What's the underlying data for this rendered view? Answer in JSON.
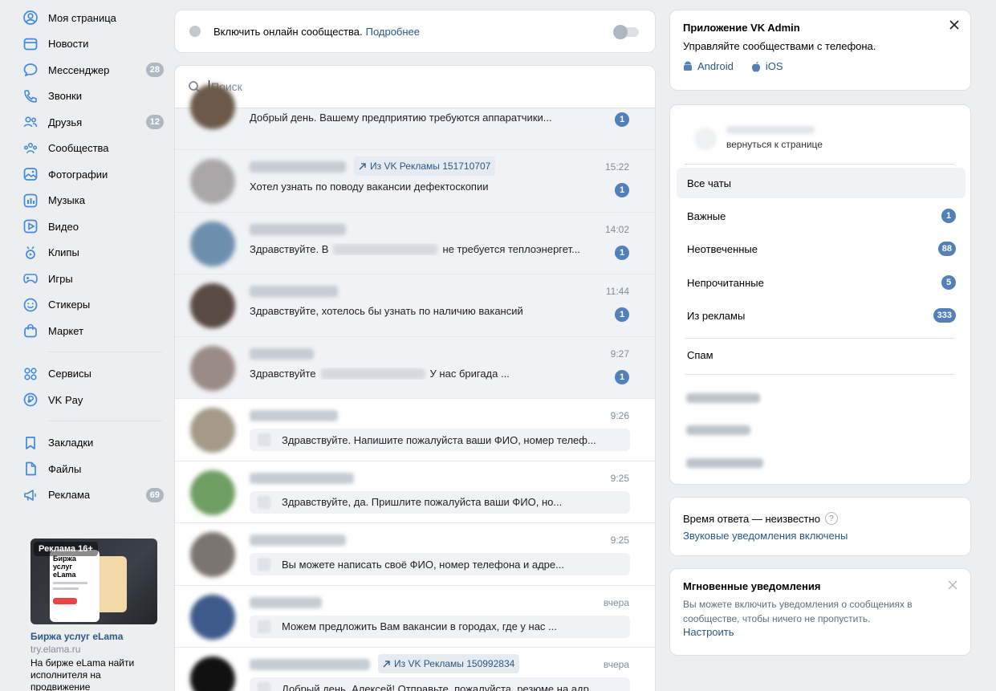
{
  "nav": {
    "items": [
      {
        "label": "Моя страница",
        "icon": "user-circle-icon",
        "count": ""
      },
      {
        "label": "Новости",
        "icon": "news-icon",
        "count": ""
      },
      {
        "label": "Мессенджер",
        "icon": "message-icon",
        "count": "28"
      },
      {
        "label": "Звонки",
        "icon": "phone-icon",
        "count": ""
      },
      {
        "label": "Друзья",
        "icon": "friends-icon",
        "count": "12"
      },
      {
        "label": "Сообщества",
        "icon": "communities-icon",
        "count": ""
      },
      {
        "label": "Фотографии",
        "icon": "photo-icon",
        "count": ""
      },
      {
        "label": "Музыка",
        "icon": "music-icon",
        "count": ""
      },
      {
        "label": "Видео",
        "icon": "video-icon",
        "count": ""
      },
      {
        "label": "Клипы",
        "icon": "clips-icon",
        "count": ""
      },
      {
        "label": "Игры",
        "icon": "gamepad-icon",
        "count": ""
      },
      {
        "label": "Стикеры",
        "icon": "smile-icon",
        "count": ""
      },
      {
        "label": "Маркет",
        "icon": "market-bag-icon",
        "count": ""
      }
    ],
    "items2": [
      {
        "label": "Сервисы",
        "icon": "services-grid-icon",
        "count": ""
      },
      {
        "label": "VK Pay",
        "icon": "vkpay-icon",
        "count": ""
      }
    ],
    "items3": [
      {
        "label": "Закладки",
        "icon": "bookmark-icon",
        "count": ""
      },
      {
        "label": "Файлы",
        "icon": "file-icon",
        "count": ""
      },
      {
        "label": "Реклама",
        "icon": "megaphone-icon",
        "count": "69"
      }
    ]
  },
  "ad": {
    "tag": "Реклама 16+",
    "phone_title": "Биржа услуг eLama",
    "title": "Биржа услуг eLama",
    "domain": "try.elama.ru",
    "desc": "На бирже eLama найти исполнителя на продвижение"
  },
  "online": {
    "text": "Включить онлайн сообщества.",
    "link": "Подробнее"
  },
  "search": {
    "placeholder": "Поиск"
  },
  "dialogs": [
    {
      "type": "partial",
      "msg": "Добрый день. Вашему предприятию требуются аппаратчики...",
      "badge": "1",
      "avatar": "#6b5a48"
    },
    {
      "type": "unread",
      "adtag": "Из VK Рекламы 151710707",
      "time": "15:22",
      "msg": "Хотел узнать по поводу вакансии дефектоскопии",
      "badge": "1",
      "avatar": "#a9a7a8",
      "nameW": 120
    },
    {
      "type": "unread",
      "time": "14:02",
      "msg_pre": "Здравствуйте. В",
      "msg_post": "не требуется теплоэнергет...",
      "badge": "1",
      "avatar": "#6d8fae",
      "nameW": 120
    },
    {
      "type": "unread",
      "time": "11:44",
      "msg": "Здравствуйте, хотелось бы узнать по наличию вакансий",
      "badge": "1",
      "avatar": "#5a4a44",
      "nameW": 110
    },
    {
      "type": "unread",
      "time": "9:27",
      "msg_pre": "Здравствуйте",
      "msg_post": "У нас бригада ...",
      "badge": "1",
      "avatar": "#9b8b86",
      "nameW": 80
    },
    {
      "type": "reply",
      "time": "9:26",
      "msg": "Здравствуйте. Напишите пожалуйста ваши ФИО, номер телеф...",
      "avatar": "#a39b86",
      "nameW": 110
    },
    {
      "type": "reply",
      "time": "9:25",
      "msg": "Здравствуйте, да. Пришлите пожалуйста ваши ФИО, но...",
      "avatar": "#6f9e63",
      "nameW": 130
    },
    {
      "type": "reply",
      "time": "9:25",
      "msg": "Вы можете написать своё ФИО, номер телефона и адре...",
      "avatar": "#7b7470",
      "nameW": 120
    },
    {
      "type": "reply",
      "time": "вчера",
      "msg": "Можем предложить Вам вакансии в городах, где у нас ...",
      "avatar": "#3d5a8a",
      "nameW": 90
    },
    {
      "type": "reply",
      "adtag": "Из VK Рекламы 150992834",
      "time": "вчера",
      "msg": "Добрый день, Алексей! Отправьте, пожалуйста, резюме на адр...",
      "avatar": "#111111",
      "nameW": 150
    }
  ],
  "vkadmin": {
    "title": "Приложение VK Admin",
    "sub": "Управляйте сообществами с телефона.",
    "android": "Android",
    "ios": "iOS"
  },
  "folders": {
    "back": "вернуться к странице",
    "items": [
      {
        "label": "Все чаты",
        "count": ""
      },
      {
        "label": "Важные",
        "count": "1"
      },
      {
        "label": "Неотвеченные",
        "count": "88"
      },
      {
        "label": "Непрочитанные",
        "count": "5"
      },
      {
        "label": "Из рекламы",
        "count": "333"
      }
    ],
    "spam": "Спам"
  },
  "resp": {
    "line1": "Время ответа — неизвестно",
    "q": "?",
    "line2": "Звуковые уведомления включены"
  },
  "instant": {
    "title": "Мгновенные уведомления",
    "desc": "Вы можете включить уведомления о сообщениях в сообществе, чтобы ничего не пропустить.",
    "link": "Настроить"
  },
  "colors": {
    "accent": "#5181b8",
    "link": "#2a5885",
    "bg": "#edeef0",
    "icon": "#3f8ae0"
  }
}
